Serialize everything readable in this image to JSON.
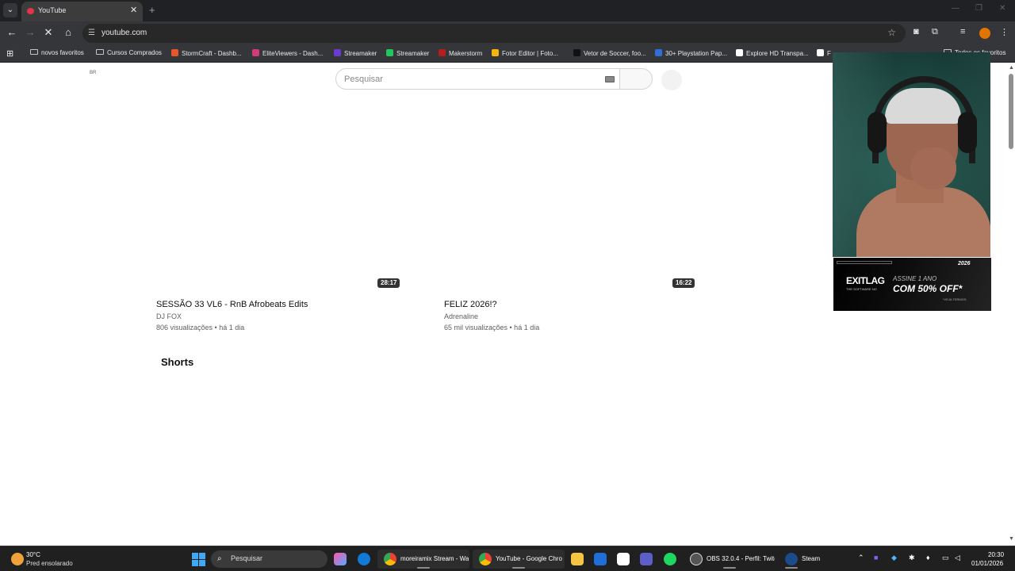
{
  "browser": {
    "tab_title": "YouTube",
    "tab_close": "✕",
    "new_tab": "+",
    "url": "youtube.com",
    "bookmarks": [
      {
        "label": "novos favoritos",
        "kind": "folder"
      },
      {
        "label": "Cursos Comprados",
        "kind": "folder"
      },
      {
        "label": "StormCraft - Dashb...",
        "kind": "site",
        "color": "#e8562a"
      },
      {
        "label": "EliteViewers - Dash...",
        "kind": "site",
        "color": "#d33a7a"
      },
      {
        "label": "Streamaker",
        "kind": "site",
        "color": "#6a3ad3"
      },
      {
        "label": "Streamaker",
        "kind": "site",
        "color": "#22c55e"
      },
      {
        "label": "Makerstorm",
        "kind": "site",
        "color": "#b91c1c"
      },
      {
        "label": "Fotor Editor | Foto...",
        "kind": "site",
        "color": "#f5b50a"
      },
      {
        "label": "Vetor de Soccer, foo...",
        "kind": "site",
        "color": "#111111"
      },
      {
        "label": "30+ Playstation Pap...",
        "kind": "site",
        "color": "#2f6fd6"
      },
      {
        "label": "Explore HD Transpa...",
        "kind": "site",
        "color": "#ffffff"
      },
      {
        "label": "F",
        "kind": "site",
        "color": "#ffffff"
      },
      {
        "label": "Todos os favoritos",
        "kind": "folder"
      }
    ]
  },
  "youtube": {
    "country_code": "BR",
    "search_placeholder": "Pesquisar",
    "videos": [
      {
        "title": "SESSÃO 33 VL6 - RnB Afrobeats Edits",
        "channel": "DJ FOX",
        "meta": "806 visualizações • há 1 dia",
        "duration": "28:17"
      },
      {
        "title": "FELIZ 2026!?",
        "channel": "Adrenaline",
        "meta": "65 mil visualizações • há 1 dia",
        "duration": "16:22"
      }
    ],
    "section_title": "Shorts"
  },
  "ad": {
    "year": "2026",
    "brand": "EXITLAG",
    "tagline": "THE SOFTWARE NO",
    "line1": "ASSINE 1 ANO",
    "line2": "COM 50% OFF*",
    "fine_print": "*VEJA TERMOS"
  },
  "taskbar": {
    "temperature": "30°C",
    "weather": "Pred ensolarado",
    "search_label": "Pesquisar",
    "windows": [
      {
        "label": "moreiramix Stream - Wa",
        "color": "#ea4335"
      },
      {
        "label": "YouTube - Google Chro",
        "color": "#4285f4"
      },
      {
        "label": "OBS 32.0.4 - Perfil: Twitc",
        "color": "#444444"
      },
      {
        "label": "Steam",
        "color": "#1b4b8a"
      }
    ],
    "time": "20:30",
    "date": "01/01/2026"
  }
}
